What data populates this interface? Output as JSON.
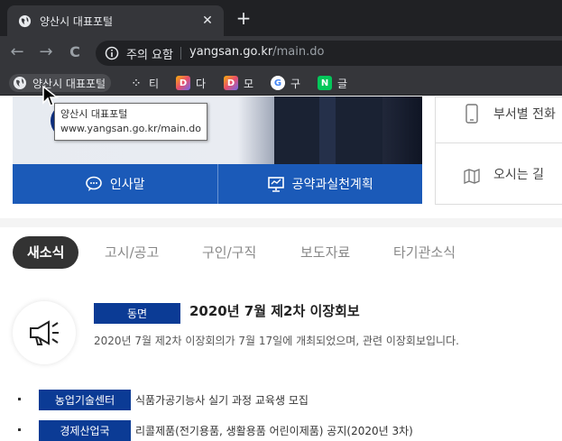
{
  "browser": {
    "tab_title": "양산시 대표포털",
    "tab_close": "✕",
    "new_tab": "+",
    "back": "←",
    "forward": "→",
    "reload": "C",
    "security_warning": "주의 요함",
    "url_domain": "yangsan.go.kr",
    "url_path": "/main.do"
  },
  "bookmarks": [
    {
      "label": "양산시 대표포털",
      "icon": "globe-icon"
    },
    {
      "label": "티",
      "icon": "tistory-icon"
    },
    {
      "label": "다",
      "icon": "daum-icon"
    },
    {
      "label": "모",
      "icon": "daum-icon"
    },
    {
      "label": "구",
      "icon": "google-icon"
    },
    {
      "label": "글",
      "icon": "naver-icon"
    }
  ],
  "tooltip": {
    "title": "양산시 대표포털",
    "url": "www.yangsan.go.kr/main.do"
  },
  "hero": {
    "buttons": [
      {
        "label": "인사말",
        "icon": "speech-bubble-icon"
      },
      {
        "label": "공약과실천계획",
        "icon": "presentation-board-icon"
      }
    ]
  },
  "right_panel": {
    "items": [
      {
        "label": "부서별 전화",
        "icon": "mobile-phone-icon"
      },
      {
        "label": "오시는 길",
        "icon": "map-icon"
      }
    ]
  },
  "news_tabs": [
    {
      "label": "새소식",
      "active": true
    },
    {
      "label": "고시/공고",
      "active": false
    },
    {
      "label": "구인/구직",
      "active": false
    },
    {
      "label": "보도자료",
      "active": false
    },
    {
      "label": "타기관소식",
      "active": false
    }
  ],
  "feature": {
    "department": "동면",
    "title": "2020년 7월 제2차 이장회보",
    "description": "2020년 7월 제2차 이장회의가 7월 17일에 개최되었으며, 관련 이장회보입니다."
  },
  "news_list": [
    {
      "department": "농업기술센터",
      "title": "식품가공기능사 실기 과정 교육생 모집"
    },
    {
      "department": "경제산업국",
      "title": "리콜제품(전기용품, 생활용품 어린이제품) 공지(2020년 3차)"
    }
  ],
  "colors": {
    "chrome_dark": "#202124",
    "chrome_toolbar": "#35363a",
    "primary_blue": "#1b5ab8",
    "badge_navy": "#0b3b95",
    "active_tab": "#333333"
  }
}
